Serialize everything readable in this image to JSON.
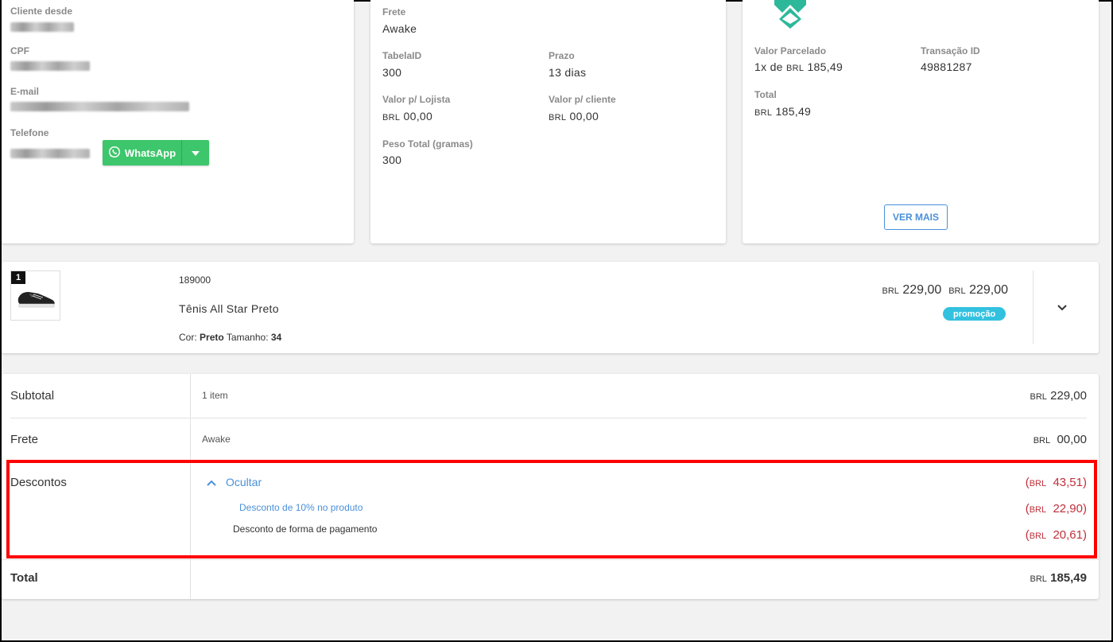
{
  "customer": {
    "since_label": "Cliente desde",
    "cpf_label": "CPF",
    "email_label": "E-mail",
    "phone_label": "Telefone",
    "whatsapp_label": "WhatsApp"
  },
  "shipping": {
    "frete_label": "Frete",
    "frete_value": "Awake",
    "tabela_label": "TabelaID",
    "tabela_value": "300",
    "prazo_label": "Prazo",
    "prazo_value": "13 dias",
    "valor_lojista_label": "Valor p/ Lojista",
    "valor_lojista_currency": "BRL",
    "valor_lojista_value": "00,00",
    "valor_cliente_label": "Valor p/ cliente",
    "valor_cliente_currency": "BRL",
    "valor_cliente_value": "00,00",
    "peso_label": "Peso Total (gramas)",
    "peso_value": "300"
  },
  "payment": {
    "parcelado_label": "Valor Parcelado",
    "parcelado_prefix": "1x de",
    "parcelado_currency": "BRL",
    "parcelado_value": "185,49",
    "transacao_label": "Transação ID",
    "transacao_value": "49881287",
    "total_label": "Total",
    "total_currency": "BRL",
    "total_value": "185,49",
    "ver_mais_label": "VER MAIS"
  },
  "item": {
    "quantity": "1",
    "sku": "189000",
    "name": "Tênis All Star Preto",
    "cor_label": "Cor:",
    "cor_value": "Preto",
    "tamanho_label": "Tamanho:",
    "tamanho_value": "34",
    "price_currency_1": "BRL",
    "price_value_1": "229,00",
    "price_currency_2": "BRL",
    "price_value_2": "229,00",
    "badge": "promoção"
  },
  "totals": {
    "subtotal_label": "Subtotal",
    "subtotal_desc": "1 item",
    "subtotal_currency": "BRL",
    "subtotal_value": "229,00",
    "frete_label": "Frete",
    "frete_desc": "Awake",
    "frete_currency": "BRL",
    "frete_value": "00,00",
    "descontos_label": "Descontos",
    "ocultar_label": "Ocultar",
    "desconto_total_open": "(",
    "desconto_total_currency": "BRL",
    "desconto_total_value": "43,51)",
    "desconto_1_label": "Desconto de 10% no produto",
    "desconto_1_open": "(",
    "desconto_1_currency": "BRL",
    "desconto_1_value": "22,90)",
    "desconto_2_label": "Desconto de forma de pagamento",
    "desconto_2_open": "(",
    "desconto_2_currency": "BRL",
    "desconto_2_value": "20,61)",
    "total_label": "Total",
    "total_currency": "BRL",
    "total_value": "185,49"
  },
  "colors": {
    "whatsapp": "#3dc66b",
    "accent_blue": "#4a90d9",
    "discount_red": "#c0303c",
    "badge": "#33c1e0",
    "highlight_border": "#ff0000"
  },
  "icons": [
    "whatsapp-icon",
    "chevron-down-icon",
    "chevron-up-icon",
    "brand-logo-icon",
    "product-thumbnail"
  ]
}
